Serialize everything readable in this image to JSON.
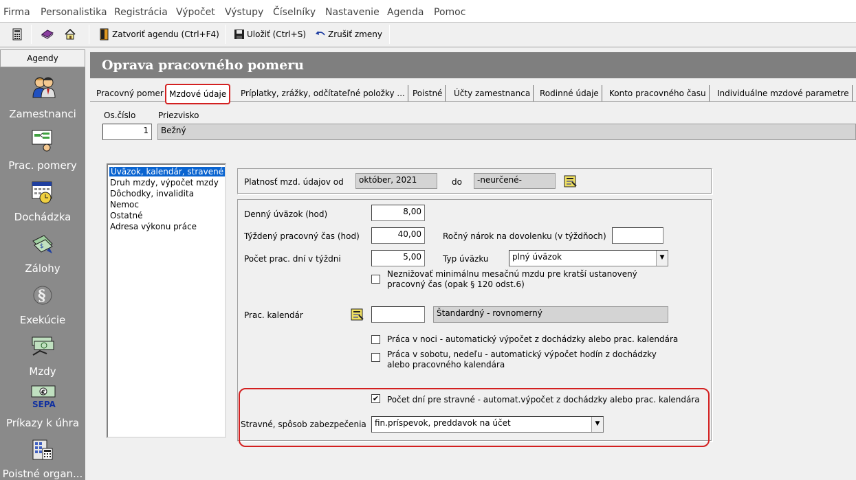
{
  "menu": [
    "Firma",
    "Personalistika",
    "Registrácia",
    "Výpočet",
    "Výstupy",
    "Číselníky",
    "Nastavenie",
    "Agenda",
    "Pomoc"
  ],
  "toolbar": {
    "close_agenda": "Zatvoriť agendu (Ctrl+F4)",
    "save": "Uložiť (Ctrl+S)",
    "cancel_changes": "Zrušiť zmeny"
  },
  "sidebar": {
    "header": "Agendy",
    "items": [
      "Zamestnanci",
      "Prac. pomery",
      "Dochádzka",
      "Zálohy",
      "Exekúcie",
      "Mzdy",
      "Príkazy k úhra",
      "Poistné organ..."
    ],
    "sepa_text": "SEPA",
    "euro_text": "€"
  },
  "title": "Oprava pracovného pomeru",
  "tabs": [
    "Pracovný pomer",
    "Mzdové údaje",
    "Príplatky, zrážky, odčítateľné položky ...",
    "Poistné",
    "Účty zamestnanca",
    "Rodinné údaje",
    "Konto pracovného času",
    "Individuálne mzdové parametre"
  ],
  "employee": {
    "os_cislo_label": "Os.číslo",
    "priezvisko_label": "Priezvisko",
    "os_cislo": "1",
    "priezvisko": "Bežný"
  },
  "sections": [
    "Úväzok, kalendár, stravené",
    "Druh mzdy, výpočet mzdy",
    "Dôchodky, invalidita",
    "Nemoc",
    "Ostatné",
    "Adresa výkonu práce"
  ],
  "validity": {
    "label": "Platnosť mzd. údajov od",
    "from": "október, 2021",
    "to_label": "do",
    "to": "-neurčené-"
  },
  "form": {
    "denny_label": "Denný úväzok (hod)",
    "denny": "8,00",
    "tyzdenny_label": "Týždený pracovný čas (hod)",
    "tyzdenny": "40,00",
    "rocny_label": "Ročný nárok na dovolenku (v týždňoch)",
    "rocny": "",
    "pocet_dni_label": "Počet prac. dní v týždni",
    "pocet_dni": "5,00",
    "typ_label": "Typ úväzku",
    "typ": "plný úväzok",
    "neznizovat_label": "Neznižovať minimálnu mesačnú mzdu pre kratší ustanovený pracovný čas (opak § 120 odst.6)",
    "kalendar_label": "Prac. kalendár",
    "kalendar_code": "",
    "kalendar_name": "Štandardný - rovnomerný",
    "noc_label": "Práca v noci - automatický výpočet z dochádzky alebo prac. kalendára",
    "sobota_label": "Práca v sobotu, nedeľu - automatický výpočet hodín z dochádzky alebo pracovného kalendára",
    "stravne_pocet_label": "Počet dní pre stravné - automat.výpočet z dochádzky alebo prac. kalendára",
    "stravne_pocet_checked": true,
    "stravne_sposob_label": "Stravné, spôsob zabezpečenia",
    "stravne_sposob": "fin.príspevok, preddavok na účet"
  },
  "colors": {
    "accent_red": "#d32020",
    "selection": "#0a64d0"
  }
}
